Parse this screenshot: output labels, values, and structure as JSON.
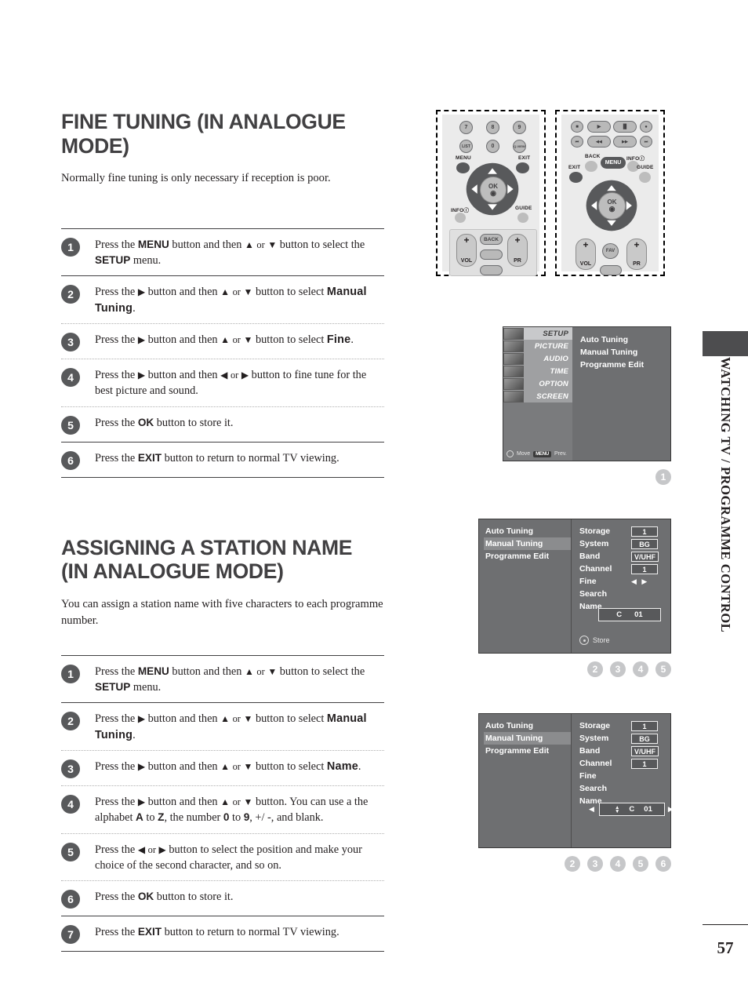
{
  "page": {
    "number": "57",
    "side_tab": "WATCHING TV / PROGRAMME CONTROL"
  },
  "section1": {
    "title_line1": "FINE TUNING (IN ANALOGUE MODE)",
    "intro": "Normally fine tuning is only necessary if reception is poor.",
    "steps": [
      {
        "num": "1",
        "html": "Press the <b>MENU</b> button and then <span class=\"ar\">▲</span> <span class=\"sm\">or</span> <span class=\"ar\">▼</span> button to select the <b>SETUP</b> menu."
      },
      {
        "num": "2",
        "html": "Press the <span class=\"ar\">▶</span> button and then <span class=\"ar\">▲</span> <span class=\"sm\">or</span> <span class=\"ar\">▼</span> button to select <span class=\"kw\">Manual Tuning</span>."
      },
      {
        "num": "3",
        "html": "Press the <span class=\"ar\">▶</span> button and then <span class=\"ar\">▲</span> <span class=\"sm\">or</span> <span class=\"ar\">▼</span> button to select <span class=\"kw\">Fine</span>."
      },
      {
        "num": "4",
        "html": "Press the <span class=\"ar\">▶</span> button and then <span class=\"ar\">◀</span> <span class=\"sm\">or</span> <span class=\"ar\">▶</span> button to fine tune for the best picture and sound."
      },
      {
        "num": "5",
        "html": "Press the <b>OK</b> button to store it."
      },
      {
        "num": "6",
        "html": "Press the <b>EXIT</b> button to return to normal TV viewing."
      }
    ],
    "separators": [
      "solid",
      "dot",
      "dot",
      "dot",
      "solid"
    ]
  },
  "section2": {
    "title_line1": "ASSIGNING A STATION NAME",
    "title_line2": "(IN ANALOGUE MODE)",
    "intro": "You can assign a station name with five characters to each programme number.",
    "steps": [
      {
        "num": "1",
        "html": "Press the <b>MENU</b> button and then <span class=\"ar\">▲</span> <span class=\"sm\">or</span> <span class=\"ar\">▼</span> button to select the <b>SETUP</b> menu."
      },
      {
        "num": "2",
        "html": "Press the <span class=\"ar\">▶</span> button and then <span class=\"ar\">▲</span> <span class=\"sm\">or</span> <span class=\"ar\">▼</span> button to select <span class=\"kw\">Manual Tuning</span>."
      },
      {
        "num": "3",
        "html": "Press the <span class=\"ar\">▶</span> button and then <span class=\"ar\">▲</span> <span class=\"sm\">or</span> <span class=\"ar\">▼</span> button to select <span class=\"kw\">Name</span>."
      },
      {
        "num": "4",
        "html": "Press the <span class=\"ar\">▶</span> button and then <span class=\"ar\">▲</span> <span class=\"sm\">or</span> <span class=\"ar\">▼</span> button. You can use a the alphabet <b>A</b> to <b>Z</b>, the number <b>0</b> to <b>9</b>, +/ -, and blank."
      },
      {
        "num": "5",
        "html": "Press the <span class=\"ar\">◀</span> <span class=\"sm\">or</span> <span class=\"ar\">▶</span> button to select the position and make your choice of the second character, and so on."
      },
      {
        "num": "6",
        "html": "Press the <b>OK</b> button to store it."
      },
      {
        "num": "7",
        "html": "Press the <b>EXIT</b> button to return to normal TV viewing."
      }
    ],
    "separators": [
      "solid",
      "dot",
      "dot",
      "dot",
      "dot",
      "solid"
    ]
  },
  "remote1": {
    "keys_row1": [
      "7",
      "8",
      "9"
    ],
    "keys_row2": [
      "LIST",
      "0",
      "Q.VIEW"
    ],
    "menu_label": "MENU",
    "exit_label": "EXIT",
    "info_label": "INFO",
    "guide_label": "GUIDE",
    "ok_label": "OK",
    "vol_label": "VOL",
    "pr_label": "PR",
    "back_label": "BACK",
    "plus": "+"
  },
  "remote2": {
    "back_label": "BACK",
    "menu_label": "MENU",
    "info_label": "INFO",
    "exit_label": "EXIT",
    "guide_label": "GUIDE",
    "ok_label": "OK",
    "vol_label": "VOL",
    "pr_label": "PR",
    "fav_label": "FAV",
    "plus": "+",
    "transport_row1": [
      "■",
      "▶",
      "▐▌",
      "●"
    ],
    "transport_row2": [
      "⏮",
      "◀◀",
      "▶▶",
      "⏭"
    ]
  },
  "osd_setup": {
    "categories": [
      "SETUP",
      "PICTURE",
      "AUDIO",
      "TIME",
      "OPTION",
      "SCREEN"
    ],
    "selected_category": "SETUP",
    "items": [
      "Auto Tuning",
      "Manual Tuning",
      "Programme Edit"
    ],
    "footer_move": "Move",
    "footer_menu_key": "MENU",
    "footer_prev": "Prev."
  },
  "osd_manual_fine": {
    "menu_items": [
      "Auto Tuning",
      "Manual Tuning",
      "Programme Edit"
    ],
    "selected_menu_item": "Manual Tuning",
    "rows": [
      {
        "label": "Storage",
        "value": "1",
        "boxed": true
      },
      {
        "label": "System",
        "value": "BG",
        "boxed": true
      },
      {
        "label": "Band",
        "value": "V/UHF",
        "boxed": true
      },
      {
        "label": "Channel",
        "value": "1",
        "boxed": true
      },
      {
        "label": "Fine",
        "value": "◀ ▶",
        "boxed": false
      },
      {
        "label": "Search",
        "value": "",
        "boxed": false
      },
      {
        "label": "Name",
        "value": "",
        "boxed": false
      }
    ],
    "name_box": {
      "letter": "C",
      "number": "01"
    },
    "store_label": "Store"
  },
  "osd_manual_name": {
    "menu_items": [
      "Auto Tuning",
      "Manual Tuning",
      "Programme Edit"
    ],
    "selected_menu_item": "Manual Tuning",
    "rows": [
      {
        "label": "Storage",
        "value": "1",
        "boxed": true
      },
      {
        "label": "System",
        "value": "BG",
        "boxed": true
      },
      {
        "label": "Band",
        "value": "V/UHF",
        "boxed": true
      },
      {
        "label": "Channel",
        "value": "1",
        "boxed": true
      },
      {
        "label": "Fine",
        "value": "",
        "boxed": false
      },
      {
        "label": "Search",
        "value": "",
        "boxed": false
      },
      {
        "label": "Name",
        "value": "",
        "boxed": false
      }
    ],
    "name_box": {
      "letter": "C",
      "number": "01",
      "left_arrow": "◀",
      "right_arrow": "▶",
      "updown": "▲▼"
    }
  },
  "badges": {
    "row1": [
      "1"
    ],
    "row2": [
      "2",
      "3",
      "4",
      "5"
    ],
    "row3": [
      "2",
      "3",
      "4",
      "5",
      "6"
    ]
  },
  "colors": {
    "badge_dark": "#58595b",
    "badge_light": "#c6c7c9",
    "title_grey": "#414042",
    "osd_bg": "#6e6f71"
  }
}
